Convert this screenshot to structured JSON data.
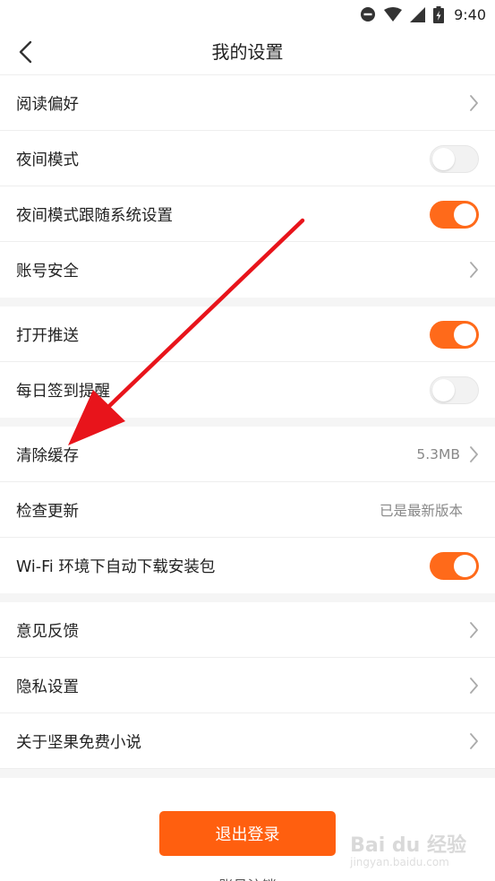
{
  "status_bar": {
    "time": "9:40"
  },
  "header": {
    "title": "我的设置"
  },
  "groups": [
    [
      {
        "label": "阅读偏好",
        "control": "chevron"
      },
      {
        "label": "夜间模式",
        "control": "toggle",
        "on": false
      },
      {
        "label": "夜间模式跟随系统设置",
        "control": "toggle",
        "on": true
      },
      {
        "label": "账号安全",
        "control": "chevron"
      }
    ],
    [
      {
        "label": "打开推送",
        "control": "toggle",
        "on": true
      },
      {
        "label": "每日签到提醒",
        "control": "toggle",
        "on": false
      }
    ],
    [
      {
        "label": "清除缓存",
        "value": "5.3MB",
        "control": "chevron"
      },
      {
        "label": "检查更新",
        "value": "已是最新版本",
        "control": "none"
      },
      {
        "label": "Wi-Fi 环境下自动下载安装包",
        "control": "toggle",
        "on": true
      }
    ],
    [
      {
        "label": "意见反馈",
        "control": "chevron"
      },
      {
        "label": "隐私设置",
        "control": "chevron"
      },
      {
        "label": "关于坚果免费小说",
        "control": "chevron"
      }
    ]
  ],
  "footer": {
    "logout_label": "退出登录",
    "cancel_account_label": "账号注销"
  },
  "watermark": {
    "main": "Bai du 经验",
    "sub": "jingyan.baidu.com"
  },
  "colors": {
    "accent": "#ff6a1a",
    "logout": "#ff5f0f",
    "arrow": "#e8141b"
  },
  "icons": {
    "back": "back-arrow-icon",
    "chevron": "chevron-right-icon"
  }
}
